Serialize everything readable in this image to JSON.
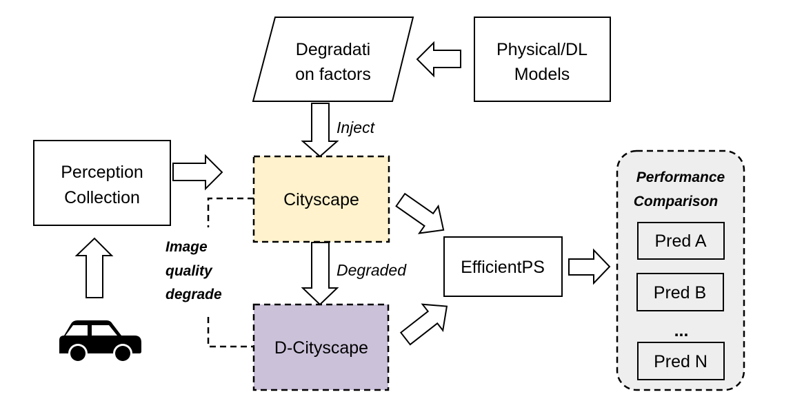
{
  "nodes": {
    "degradation": {
      "line1": "Degradati",
      "line2": "on factors"
    },
    "models": {
      "line1": "Physical/DL",
      "line2": "Models"
    },
    "perception": {
      "line1": "Perception",
      "line2": "Collection"
    },
    "cityscape": {
      "label": "Cityscape",
      "fill": "#fff2cc"
    },
    "d_cityscape": {
      "label": "D-Cityscape",
      "fill": "#cbc1d9"
    },
    "efficientps": {
      "label": "EfficientPS"
    },
    "performance": {
      "line1": "Performance",
      "line2": "Comparison",
      "fill": "#eeeeee",
      "preds": [
        "Pred A",
        "Pred B",
        "Pred N"
      ],
      "ellipsis": "..."
    }
  },
  "edges": {
    "inject": "Inject",
    "degraded": "Degraded",
    "image_quality": {
      "line1": "Image",
      "line2": "quality",
      "line3": "degrade"
    }
  },
  "icons": {
    "vehicle": "car-icon"
  }
}
